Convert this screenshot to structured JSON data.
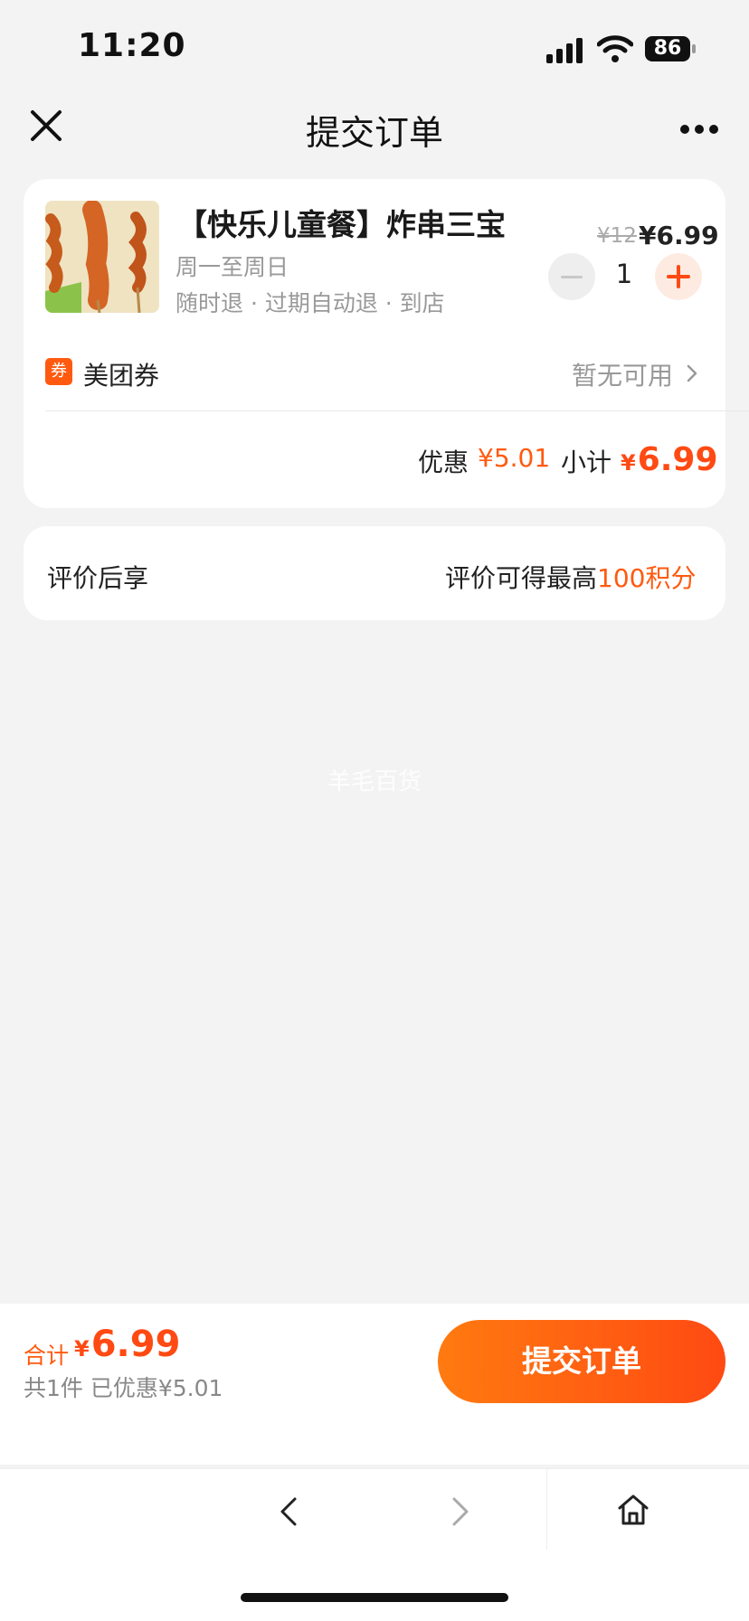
{
  "status_bar": {
    "time": "11:20",
    "battery": "86"
  },
  "nav": {
    "title": "提交订单"
  },
  "order": {
    "product_name": "【快乐儿童餐】炸串三宝",
    "validity": "周一至周日",
    "tags": "随时退 · 过期自动退 · 到店",
    "original_price": "¥12",
    "price": "¥6.99",
    "quantity": "1",
    "coupon_icon_text": "券",
    "coupon_label": "美团券",
    "coupon_status": "暂无可用",
    "discount_label": "优惠",
    "discount_value": "¥5.01",
    "subtotal_label": "小计",
    "subtotal_currency": "¥",
    "subtotal_value": "6.99"
  },
  "review": {
    "label": "评价后享",
    "desc_prefix": "评价可得最高",
    "desc_points": "100积分"
  },
  "watermark": "羊毛百货",
  "footer": {
    "total_label": "合计",
    "total_currency": "¥",
    "total_value": "6.99",
    "summary": "共1件  已优惠¥5.01",
    "submit_label": "提交订单"
  },
  "colors": {
    "accent": "#ff4a13",
    "accent_light": "#ff7a10",
    "background": "#f3f3f3"
  },
  "icons": [
    "close-icon",
    "more-icon",
    "signal-icon",
    "wifi-icon",
    "battery-icon",
    "chevron-right-icon",
    "back-icon",
    "forward-icon",
    "home-icon"
  ]
}
